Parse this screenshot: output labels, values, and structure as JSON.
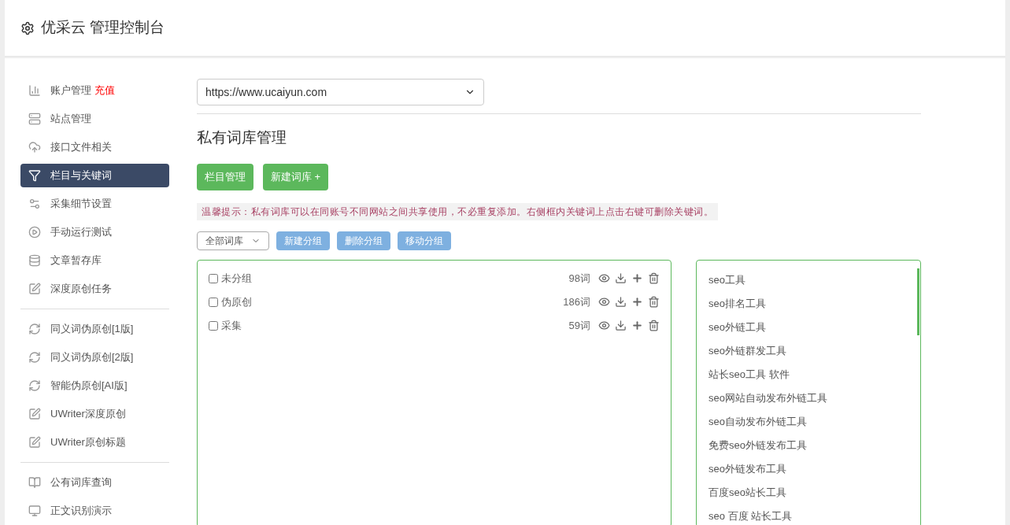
{
  "header": {
    "title": "优采云 管理控制台"
  },
  "sidebar": {
    "groups": [
      {
        "items": [
          {
            "label": "账户管理",
            "badge": "充值",
            "selected": false
          },
          {
            "label": "站点管理",
            "selected": false
          },
          {
            "label": "接口文件相关",
            "selected": false
          },
          {
            "label": "栏目与关键词",
            "selected": true
          },
          {
            "label": "采集细节设置",
            "selected": false
          },
          {
            "label": "手动运行测试",
            "selected": false
          },
          {
            "label": "文章暂存库",
            "selected": false
          },
          {
            "label": "深度原创任务",
            "selected": false
          }
        ]
      },
      {
        "items": [
          {
            "label": "同义词伪原创[1版]",
            "selected": false
          },
          {
            "label": "同义词伪原创[2版]",
            "selected": false
          },
          {
            "label": "智能伪原创[AI版]",
            "selected": false
          },
          {
            "label": "UWriter深度原创",
            "selected": false
          },
          {
            "label": "UWriter原创标题",
            "selected": false
          }
        ]
      },
      {
        "items": [
          {
            "label": "公有词库查询",
            "selected": false
          },
          {
            "label": "正文识别演示",
            "selected": false
          }
        ]
      }
    ]
  },
  "site_select": {
    "value": "https://www.ucaiyun.com"
  },
  "section_title": "私有词库管理",
  "primary_buttons": [
    "栏目管理",
    "新建词库 +"
  ],
  "tip": "温馨提示：私有词库可以在同账号不同网站之间共享使用，不必重复添加。右侧框内关键词上点击右键可删除关键词。",
  "filter_select": {
    "value": "全部词库"
  },
  "group_buttons": [
    "新建分组",
    "删除分组",
    "移动分组"
  ],
  "libraries": [
    {
      "name": "未分组",
      "count": "98词",
      "checked": false
    },
    {
      "name": "伪原创",
      "count": "186词",
      "checked": false
    },
    {
      "name": "采集",
      "count": "59词",
      "checked": false
    }
  ],
  "keywords": [
    "seo工具",
    "seo排名工具",
    "seo外链工具",
    "seo外链群发工具",
    "站长seo工具 软件",
    "seo网站自动发布外链工具",
    "seo自动发布外链工具",
    "免费seo外链发布工具",
    "seo外链发布工具",
    "百度seo站长工具",
    "seo 百度 站长工具"
  ]
}
